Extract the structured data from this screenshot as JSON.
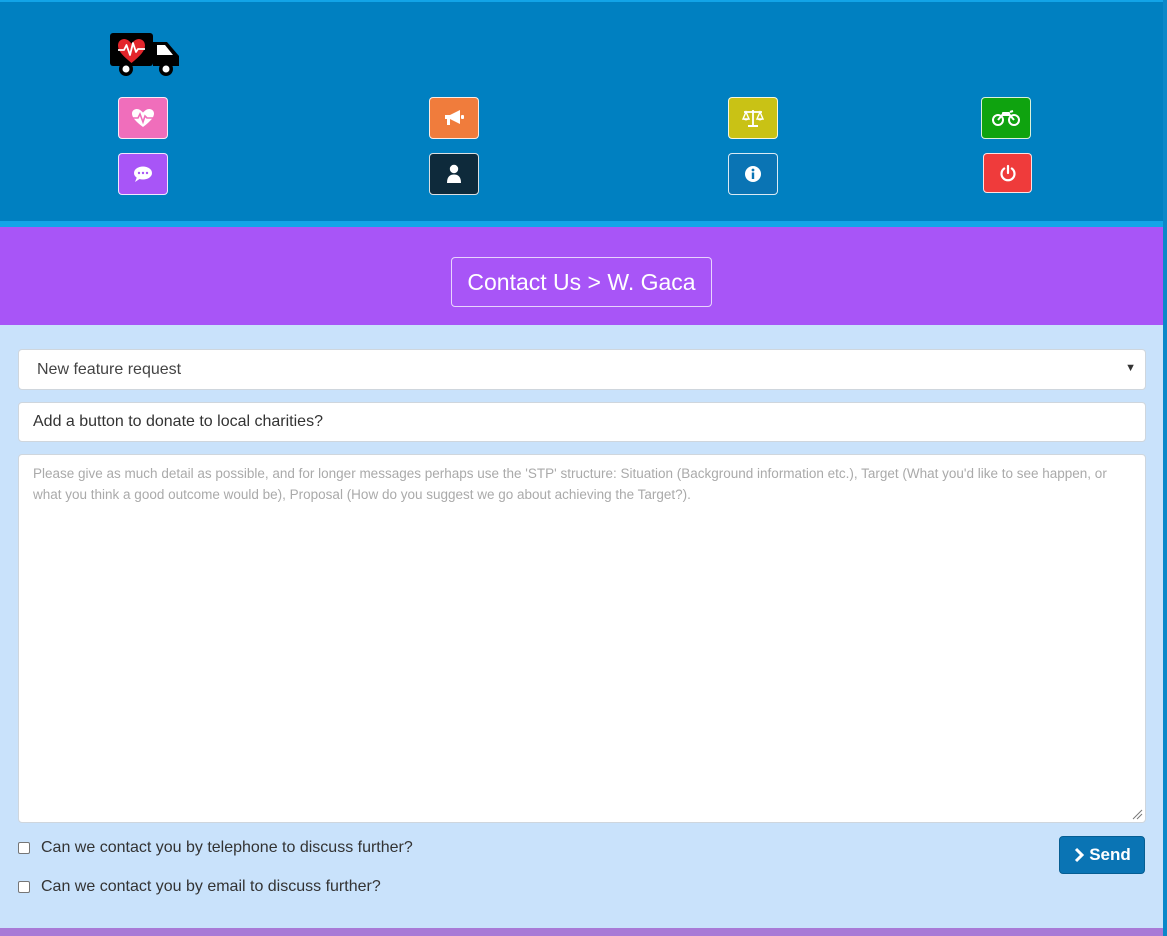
{
  "nav": {
    "buttons": [
      {
        "icon": "heartbeat-icon",
        "color": "#f06ebb"
      },
      {
        "icon": "megaphone-icon",
        "color": "#f07c3c"
      },
      {
        "icon": "scales-icon",
        "color": "#c9c215"
      },
      {
        "icon": "motorbike-icon",
        "color": "#0fa30f"
      },
      {
        "icon": "chat-bubble-icon",
        "color": "#a855f7"
      },
      {
        "icon": "user-icon",
        "color": "#0e2a3b"
      },
      {
        "icon": "info-icon",
        "color": "#0a74b4"
      },
      {
        "icon": "power-icon",
        "color": "#ef3b3b"
      }
    ]
  },
  "logo": {
    "icon": "ambulance-heart-icon"
  },
  "title": {
    "text": "Contact Us > W. Gaca"
  },
  "form": {
    "topic_selected": "New feature request",
    "subject_value": "Add a button to donate to local charities?",
    "message_placeholder": "Please give as much detail as possible, and for longer messages perhaps use the 'STP' structure: Situation (Background information etc.), Target (What you'd like to see happen, or what you think a good outcome would be), Proposal (How do you suggest we go about achieving the Target?).",
    "contact_phone_label": "Can we contact you by telephone to discuss further?",
    "contact_email_label": "Can we contact you by email to discuss further?",
    "send_label": "Send"
  },
  "colors": {
    "header": "#0080c1",
    "title_band": "#a855f7",
    "form_background": "#c9e2fb",
    "send_button": "#0a74b4"
  }
}
